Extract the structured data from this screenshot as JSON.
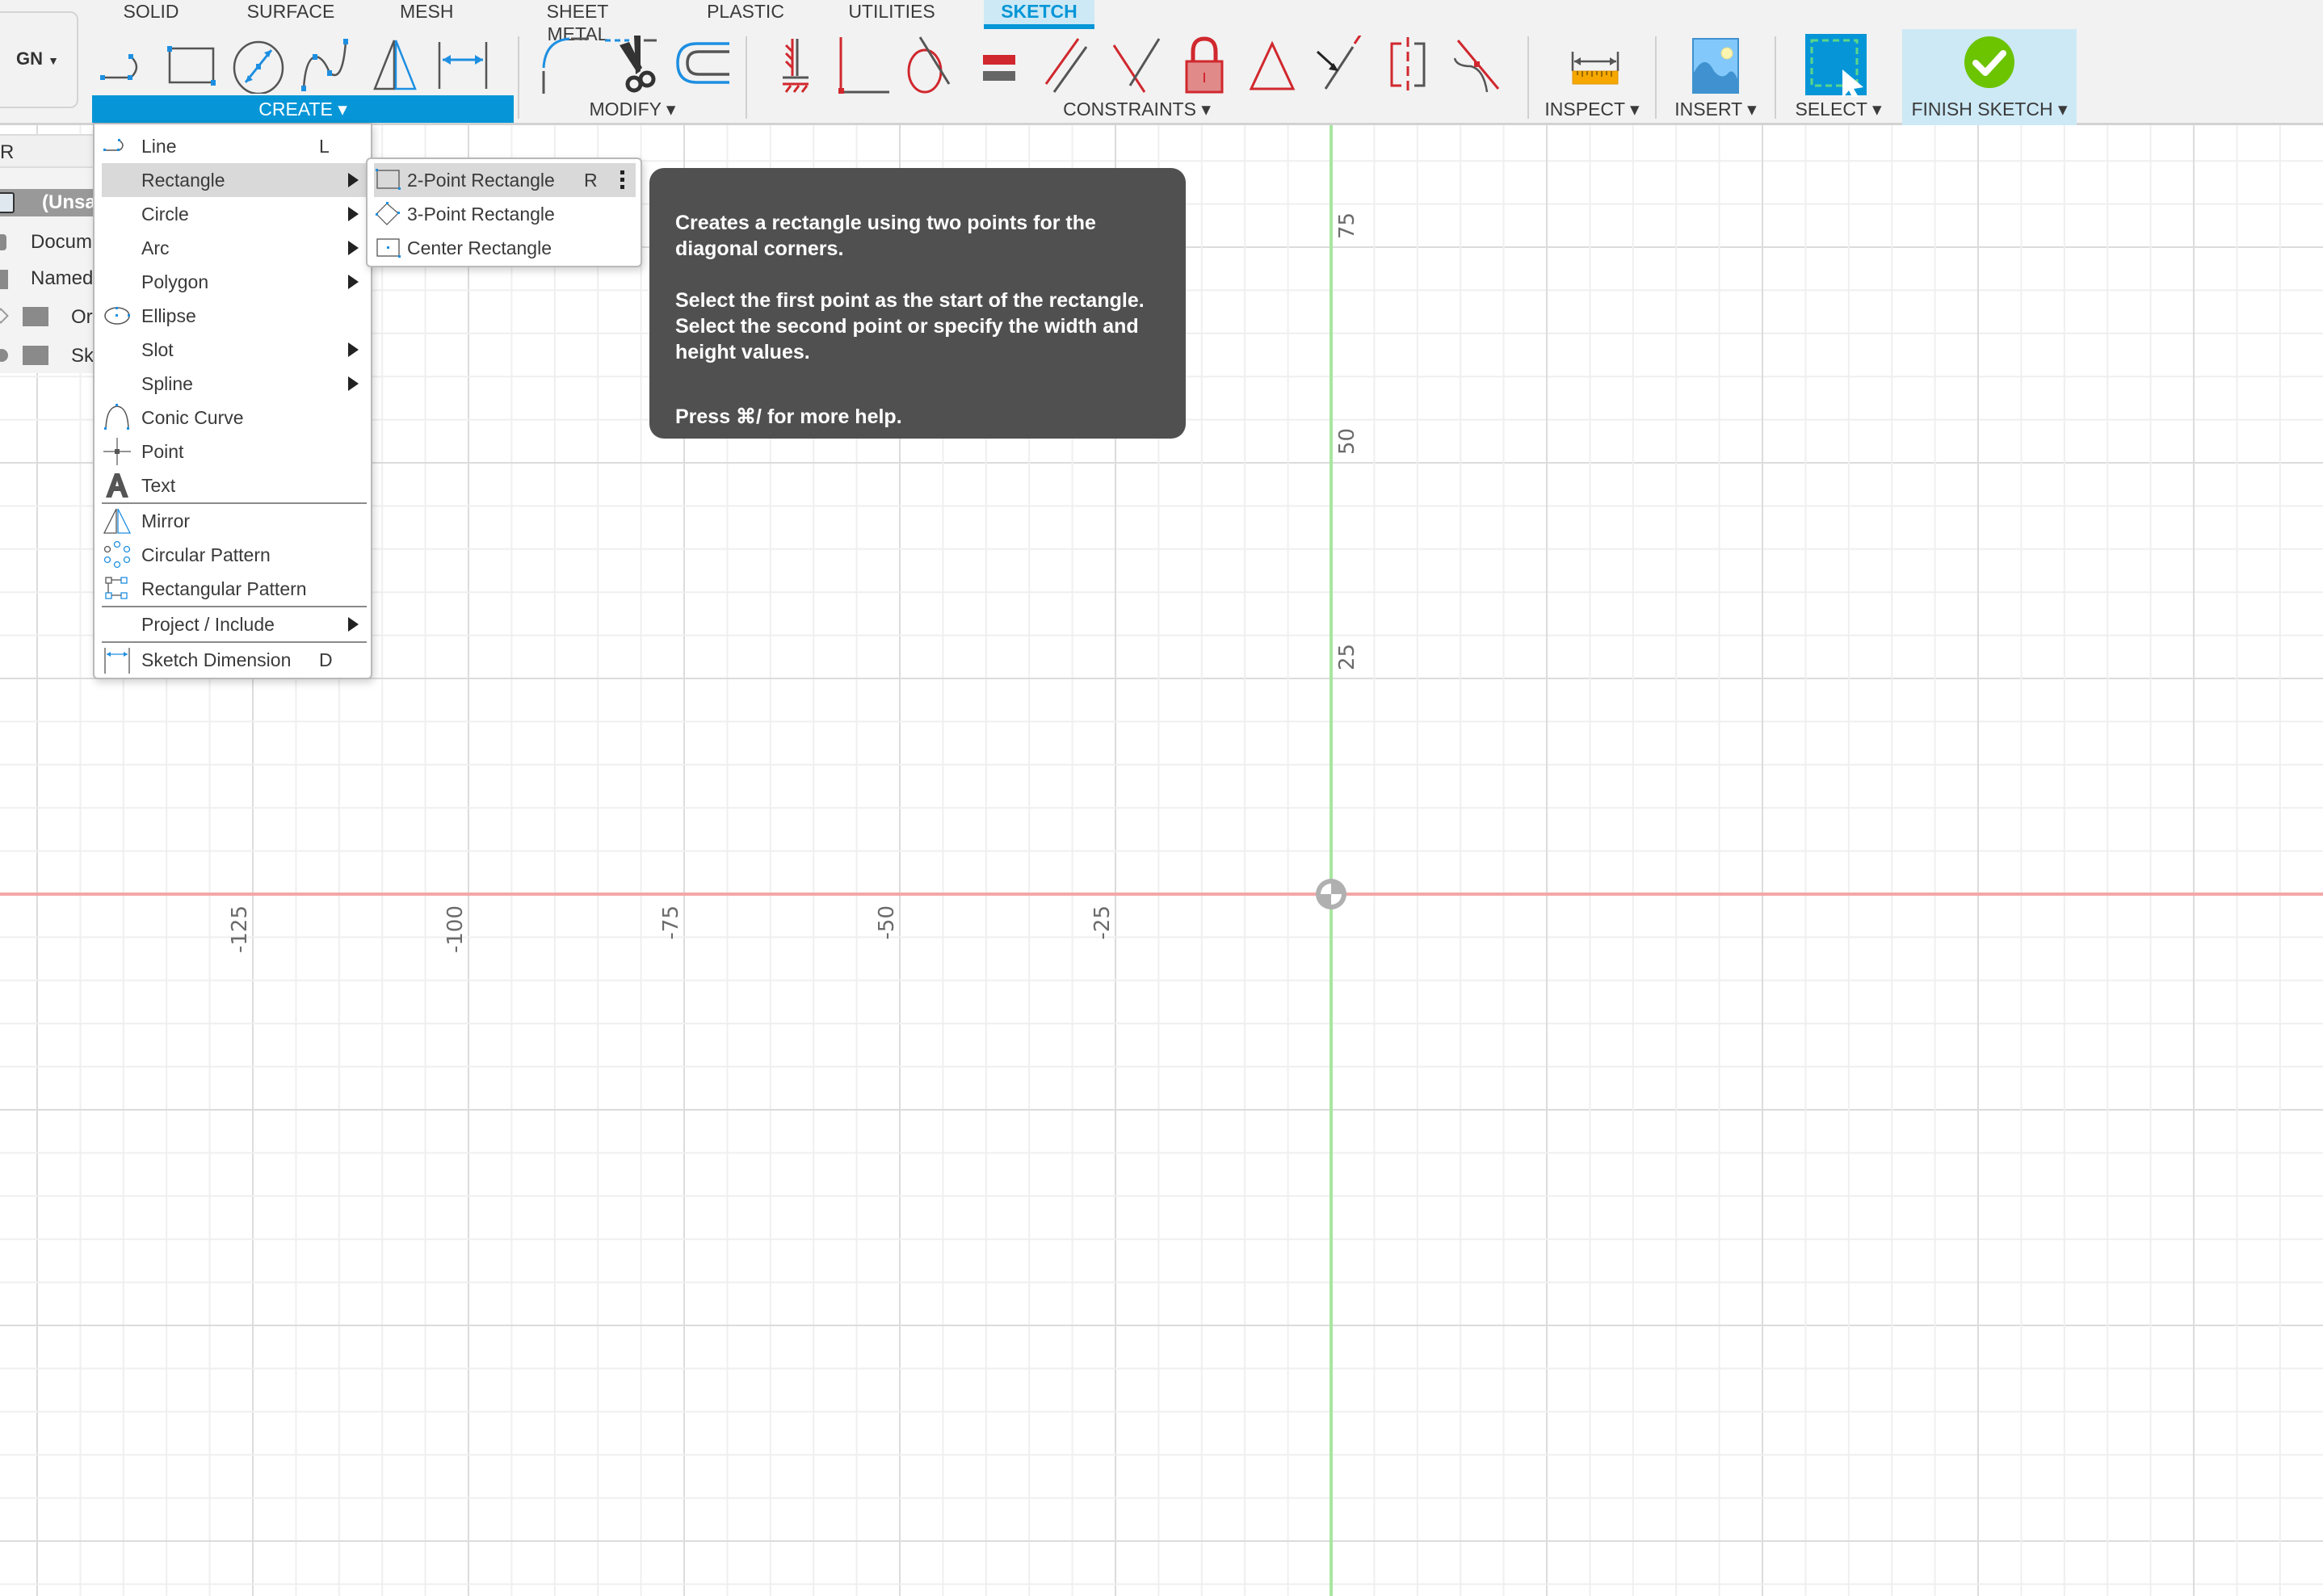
{
  "workspace_button": {
    "label": "GN",
    "icon": "chevron-down-icon"
  },
  "tabs": [
    {
      "label": "SOLID",
      "active": false
    },
    {
      "label": "SURFACE",
      "active": false
    },
    {
      "label": "MESH",
      "active": false
    },
    {
      "label": "SHEET METAL",
      "active": false
    },
    {
      "label": "PLASTIC",
      "active": false
    },
    {
      "label": "UTILITIES",
      "active": false
    },
    {
      "label": "SKETCH",
      "active": true
    }
  ],
  "toolbar": {
    "create": {
      "label": "CREATE ▾",
      "tools": [
        "line-icon",
        "rectangle-icon",
        "circle-icon",
        "spline-icon",
        "mirror-icon",
        "dimension-icon"
      ]
    },
    "modify": {
      "label": "MODIFY ▾",
      "tools": [
        "fillet-icon",
        "trim-icon",
        "offset-icon"
      ]
    },
    "constraints": {
      "label": "CONSTRAINTS ▾",
      "tools": [
        "coincident-fix-icon",
        "perpendicular-icon",
        "tangent-icon",
        "equal-icon",
        "parallel-icon",
        "intersect-icon",
        "fix-lock-icon",
        "triangle-icon",
        "midpoint-icon",
        "symmetry-icon",
        "curvature-icon"
      ]
    },
    "inspect": {
      "label": "INSPECT ▾",
      "icon": "measure-ruler-icon"
    },
    "insert": {
      "label": "INSERT ▾",
      "icon": "insert-image-icon"
    },
    "select": {
      "label": "SELECT ▾",
      "icon": "select-window-icon"
    },
    "finish_sketch": {
      "label": "FINISH SKETCH ▾",
      "icon": "green-checkmark-icon"
    }
  },
  "browser": {
    "header": "R",
    "rows": [
      {
        "label": "(Unsa",
        "icon": "component-box-icon"
      },
      {
        "label": "Docum",
        "icon": "gear-icon"
      },
      {
        "label": "Named",
        "icon": "named-views-icon"
      },
      {
        "label": "Or",
        "icon": "folder-icon"
      },
      {
        "label": "Sk",
        "icon": "folder-icon"
      }
    ]
  },
  "create_menu": {
    "items": [
      {
        "label": "Line",
        "shortcut": "L",
        "icon": "line-icon",
        "submenu": false
      },
      {
        "label": "Rectangle",
        "shortcut": "",
        "icon": "",
        "submenu": true,
        "highlighted": true
      },
      {
        "label": "Circle",
        "shortcut": "",
        "icon": "",
        "submenu": true
      },
      {
        "label": "Arc",
        "shortcut": "",
        "icon": "",
        "submenu": true
      },
      {
        "label": "Polygon",
        "shortcut": "",
        "icon": "",
        "submenu": true
      },
      {
        "label": "Ellipse",
        "shortcut": "",
        "icon": "ellipse-icon",
        "submenu": false
      },
      {
        "label": "Slot",
        "shortcut": "",
        "icon": "",
        "submenu": true
      },
      {
        "label": "Spline",
        "shortcut": "",
        "icon": "",
        "submenu": true
      },
      {
        "label": "Conic Curve",
        "shortcut": "",
        "icon": "conic-curve-icon",
        "submenu": false
      },
      {
        "label": "Point",
        "shortcut": "",
        "icon": "point-icon",
        "submenu": false
      },
      {
        "label": "Text",
        "shortcut": "",
        "icon": "text-icon",
        "submenu": false
      },
      {
        "label": "Mirror",
        "shortcut": "",
        "icon": "mirror-icon",
        "submenu": false
      },
      {
        "label": "Circular Pattern",
        "shortcut": "",
        "icon": "circular-pattern-icon",
        "submenu": false
      },
      {
        "label": "Rectangular Pattern",
        "shortcut": "",
        "icon": "rectangular-pattern-icon",
        "submenu": false
      },
      {
        "label": "Project / Include",
        "shortcut": "",
        "icon": "",
        "submenu": true
      },
      {
        "label": "Sketch Dimension",
        "shortcut": "D",
        "icon": "sketch-dimension-icon",
        "submenu": false
      }
    ]
  },
  "rectangle_submenu": {
    "items": [
      {
        "label": "2-Point Rectangle",
        "shortcut": "R",
        "icon": "two-point-rectangle-icon",
        "highlighted": true,
        "more_icon": "more-vertical-icon"
      },
      {
        "label": "3-Point Rectangle",
        "shortcut": "",
        "icon": "three-point-rectangle-icon"
      },
      {
        "label": "Center Rectangle",
        "shortcut": "",
        "icon": "center-rectangle-icon"
      }
    ]
  },
  "tooltip": {
    "paragraphs": [
      "Creates a rectangle using two points for the diagonal corners.",
      "Select the first point as the start of the rectangle. Select the second point or specify the width and height values."
    ],
    "help": "Press ⌘/ for more help."
  },
  "sketch_grid": {
    "x_axis_labels": [
      "-125",
      "-100",
      "-75",
      "-50",
      "-25"
    ],
    "y_axis_labels": [
      "75",
      "50",
      "25"
    ],
    "x_axis_color": "#f4a7a7",
    "y_axis_color": "#a8e6a0"
  },
  "colors": {
    "accent": "#0696d7",
    "finish_bg": "#cde9f6",
    "tooltip_bg": "#505050",
    "menu_highlight": "#d9d9d9",
    "constraint_red": "#d0282e"
  }
}
